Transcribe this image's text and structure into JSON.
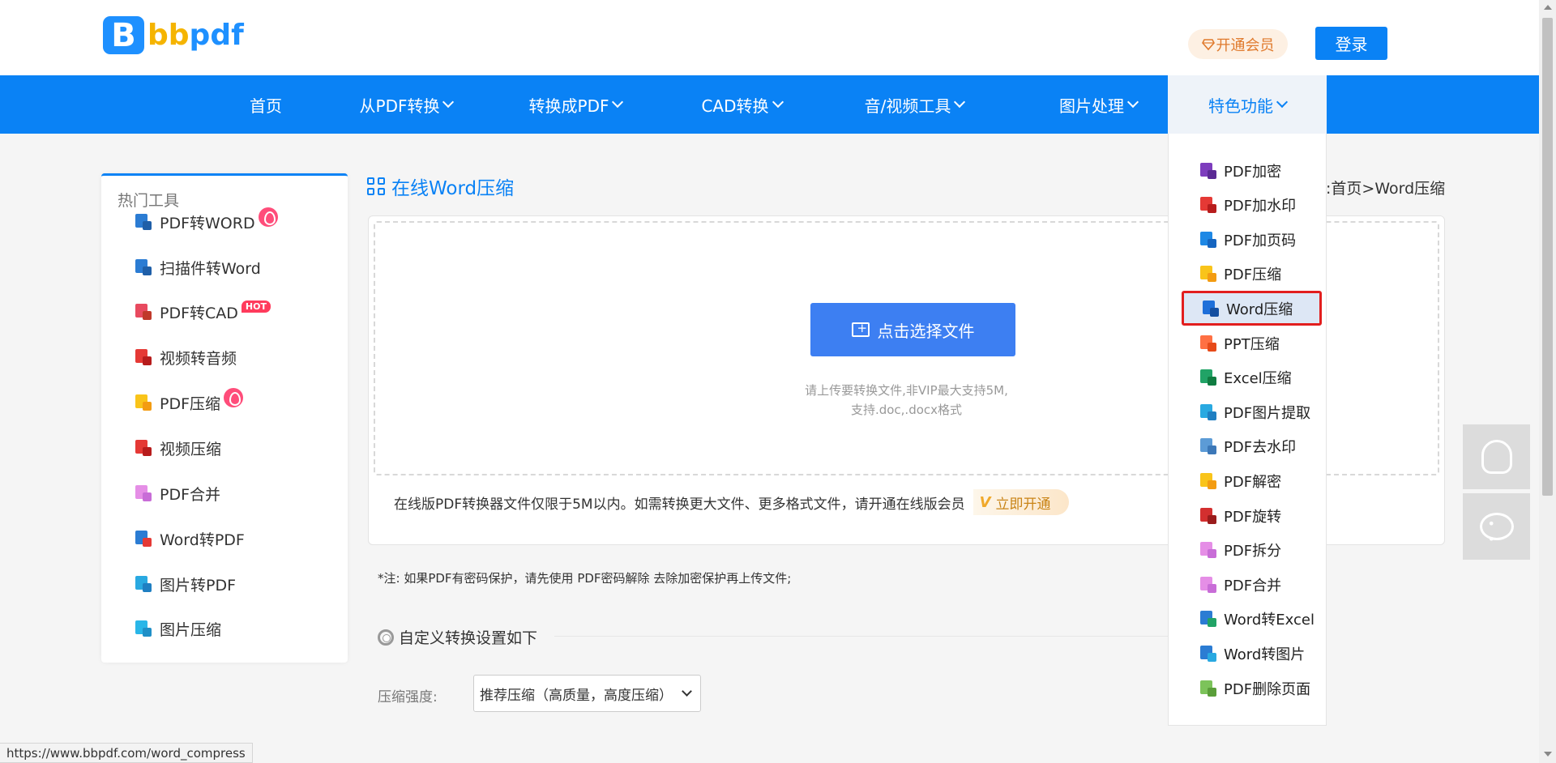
{
  "header": {
    "logo_letter": "B",
    "logo_text_1": "bb",
    "logo_text_2": "pdf",
    "vip_button": "开通会员",
    "login_button": "登录"
  },
  "nav": {
    "items": [
      {
        "label": "首页"
      },
      {
        "label": "从PDF转换"
      },
      {
        "label": "转换成PDF"
      },
      {
        "label": "CAD转换"
      },
      {
        "label": "音/视频工具"
      },
      {
        "label": "图片处理"
      },
      {
        "label": "特色功能"
      }
    ]
  },
  "sidebar": {
    "title": "热门工具",
    "items": [
      {
        "label": "PDF转WORD",
        "icon": "word-icon",
        "colors": [
          "#2b7cd3",
          "#1f5fa8"
        ]
      },
      {
        "label": "扫描件转Word",
        "icon": "word-icon",
        "colors": [
          "#2b7cd3",
          "#1f5fa8"
        ]
      },
      {
        "label": "PDF转CAD",
        "badge": "HOT",
        "icon": "cad-icon",
        "colors": [
          "#e84a5f",
          "#c0392b"
        ]
      },
      {
        "label": "视频转音频",
        "icon": "video-audio-icon",
        "colors": [
          "#e53935",
          "#b71c1c"
        ]
      },
      {
        "label": "PDF压缩",
        "icon": "pdf-compress-icon",
        "colors": [
          "#f9c41a",
          "#f39c12"
        ]
      },
      {
        "label": "视频压缩",
        "icon": "video-compress-icon",
        "colors": [
          "#e53935",
          "#b71c1c"
        ]
      },
      {
        "label": "PDF合并",
        "icon": "pdf-merge-icon",
        "colors": [
          "#e58ee6",
          "#c86dd7"
        ]
      },
      {
        "label": "Word转PDF",
        "icon": "word-pdf-icon",
        "colors": [
          "#2b7cd3",
          "#e53935"
        ]
      },
      {
        "label": "图片转PDF",
        "icon": "image-pdf-icon",
        "colors": [
          "#29a9e1",
          "#1f7fc2"
        ]
      },
      {
        "label": "图片压缩",
        "icon": "image-compress-icon",
        "colors": [
          "#29b6e8",
          "#1f8fc7"
        ]
      }
    ]
  },
  "main": {
    "title": "在线Word压缩",
    "breadcrumb": ":首页>Word压缩",
    "select_button": "点击选择文件",
    "upload_hint_1": "请上传要转换文件,非VIP最大支持5M,",
    "upload_hint_2": "支持.doc,.docx格式",
    "notice": "在线版PDF转换器文件仅限于5M以内。如需转换更大文件、更多格式文件，请开通在线版会员",
    "open_vip_icon": "V",
    "open_vip_label": "立即开通",
    "note": "*注:  如果PDF有密码保护，请先使用 PDF密码解除 去除加密保护再上传文件;",
    "settings_title": "自定义转换设置如下",
    "compress_label": "压缩强度:",
    "compress_value": "推荐压缩（高质量，高度压缩）"
  },
  "dropdown": {
    "items": [
      {
        "label": "PDF加密",
        "icon": "pdf-encrypt-icon",
        "colors": [
          "#7d3dbd",
          "#5b2a94"
        ]
      },
      {
        "label": "PDF加水印",
        "icon": "pdf-watermark-icon",
        "colors": [
          "#e53935",
          "#b71c1c"
        ]
      },
      {
        "label": "PDF加页码",
        "icon": "pdf-pagenum-icon",
        "colors": [
          "#1e88e5",
          "#1565c0"
        ]
      },
      {
        "label": "PDF压缩",
        "icon": "pdf-compress-icon",
        "colors": [
          "#f9c41a",
          "#f39c12"
        ]
      },
      {
        "label": "Word压缩",
        "icon": "word-compress-icon",
        "colors": [
          "#1e6fd9",
          "#154fa0"
        ]
      },
      {
        "label": "PPT压缩",
        "icon": "ppt-compress-icon",
        "colors": [
          "#ff7043",
          "#e64a19"
        ]
      },
      {
        "label": "Excel压缩",
        "icon": "excel-compress-icon",
        "colors": [
          "#21a366",
          "#107c41"
        ]
      },
      {
        "label": "PDF图片提取",
        "icon": "pdf-image-extract-icon",
        "colors": [
          "#29a9e1",
          "#1f7fc2"
        ]
      },
      {
        "label": "PDF去水印",
        "icon": "pdf-remove-watermark-icon",
        "colors": [
          "#5c9bd6",
          "#3c78b8"
        ]
      },
      {
        "label": "PDF解密",
        "icon": "pdf-decrypt-icon",
        "colors": [
          "#f9c41a",
          "#f39c12"
        ]
      },
      {
        "label": "PDF旋转",
        "icon": "pdf-rotate-icon",
        "colors": [
          "#d32f2f",
          "#9a1c1c"
        ]
      },
      {
        "label": "PDF拆分",
        "icon": "pdf-split-icon",
        "colors": [
          "#e58ee6",
          "#c86dd7"
        ]
      },
      {
        "label": "PDF合并",
        "icon": "pdf-merge-icon",
        "colors": [
          "#e58ee6",
          "#c86dd7"
        ]
      },
      {
        "label": "Word转Excel",
        "icon": "word-excel-icon",
        "colors": [
          "#2b7cd3",
          "#21a366"
        ]
      },
      {
        "label": "Word转图片",
        "icon": "word-image-icon",
        "colors": [
          "#2b7cd3",
          "#29a9e1"
        ]
      },
      {
        "label": "PDF删除页面",
        "icon": "pdf-delete-page-icon",
        "colors": [
          "#7cc35a",
          "#5a9e3a"
        ]
      }
    ],
    "selected_index": 4
  },
  "status_bar": {
    "url": "https://www.bbpdf.com/word_compress"
  },
  "colors": {
    "brand_blue": "#0a82f5",
    "button_blue": "#3d7ff2",
    "vip_orange": "#e07a2d",
    "highlight_red": "#e21e1e"
  }
}
